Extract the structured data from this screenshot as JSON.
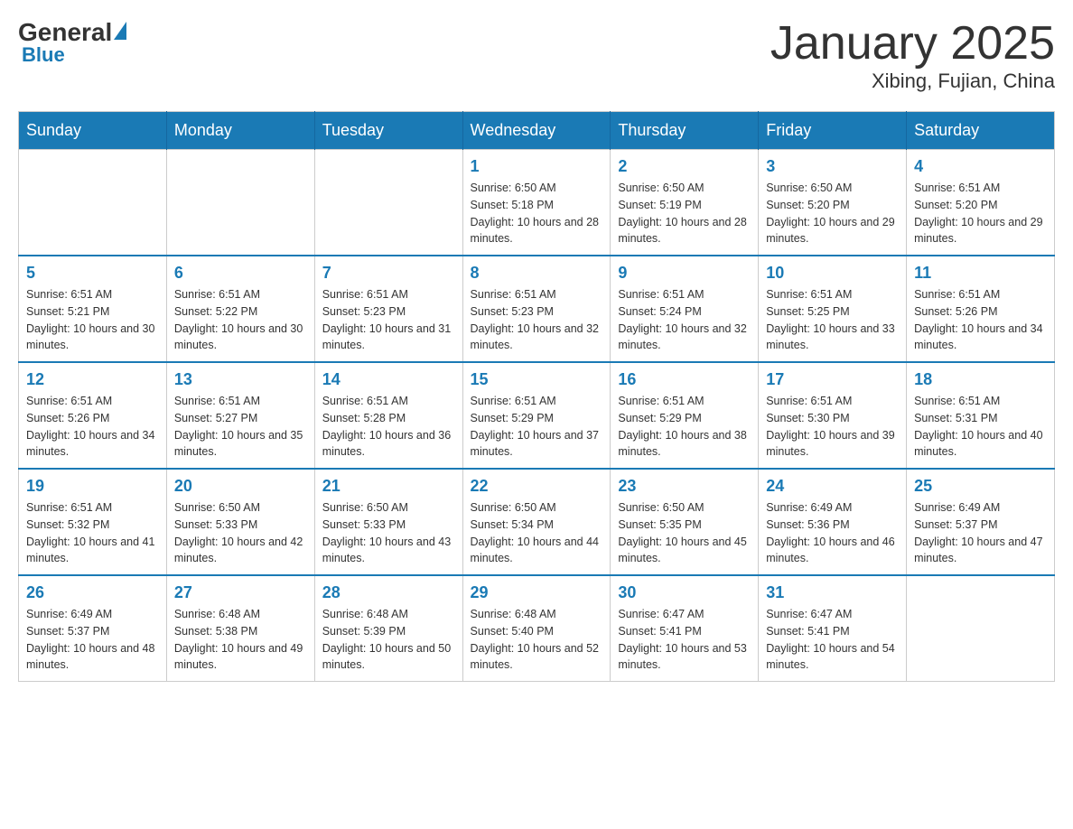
{
  "header": {
    "logo_general": "General",
    "logo_blue": "Blue",
    "month_title": "January 2025",
    "location": "Xibing, Fujian, China"
  },
  "days_of_week": [
    "Sunday",
    "Monday",
    "Tuesday",
    "Wednesday",
    "Thursday",
    "Friday",
    "Saturday"
  ],
  "weeks": [
    [
      {
        "day": "",
        "info": ""
      },
      {
        "day": "",
        "info": ""
      },
      {
        "day": "",
        "info": ""
      },
      {
        "day": "1",
        "info": "Sunrise: 6:50 AM\nSunset: 5:18 PM\nDaylight: 10 hours and 28 minutes."
      },
      {
        "day": "2",
        "info": "Sunrise: 6:50 AM\nSunset: 5:19 PM\nDaylight: 10 hours and 28 minutes."
      },
      {
        "day": "3",
        "info": "Sunrise: 6:50 AM\nSunset: 5:20 PM\nDaylight: 10 hours and 29 minutes."
      },
      {
        "day": "4",
        "info": "Sunrise: 6:51 AM\nSunset: 5:20 PM\nDaylight: 10 hours and 29 minutes."
      }
    ],
    [
      {
        "day": "5",
        "info": "Sunrise: 6:51 AM\nSunset: 5:21 PM\nDaylight: 10 hours and 30 minutes."
      },
      {
        "day": "6",
        "info": "Sunrise: 6:51 AM\nSunset: 5:22 PM\nDaylight: 10 hours and 30 minutes."
      },
      {
        "day": "7",
        "info": "Sunrise: 6:51 AM\nSunset: 5:23 PM\nDaylight: 10 hours and 31 minutes."
      },
      {
        "day": "8",
        "info": "Sunrise: 6:51 AM\nSunset: 5:23 PM\nDaylight: 10 hours and 32 minutes."
      },
      {
        "day": "9",
        "info": "Sunrise: 6:51 AM\nSunset: 5:24 PM\nDaylight: 10 hours and 32 minutes."
      },
      {
        "day": "10",
        "info": "Sunrise: 6:51 AM\nSunset: 5:25 PM\nDaylight: 10 hours and 33 minutes."
      },
      {
        "day": "11",
        "info": "Sunrise: 6:51 AM\nSunset: 5:26 PM\nDaylight: 10 hours and 34 minutes."
      }
    ],
    [
      {
        "day": "12",
        "info": "Sunrise: 6:51 AM\nSunset: 5:26 PM\nDaylight: 10 hours and 34 minutes."
      },
      {
        "day": "13",
        "info": "Sunrise: 6:51 AM\nSunset: 5:27 PM\nDaylight: 10 hours and 35 minutes."
      },
      {
        "day": "14",
        "info": "Sunrise: 6:51 AM\nSunset: 5:28 PM\nDaylight: 10 hours and 36 minutes."
      },
      {
        "day": "15",
        "info": "Sunrise: 6:51 AM\nSunset: 5:29 PM\nDaylight: 10 hours and 37 minutes."
      },
      {
        "day": "16",
        "info": "Sunrise: 6:51 AM\nSunset: 5:29 PM\nDaylight: 10 hours and 38 minutes."
      },
      {
        "day": "17",
        "info": "Sunrise: 6:51 AM\nSunset: 5:30 PM\nDaylight: 10 hours and 39 minutes."
      },
      {
        "day": "18",
        "info": "Sunrise: 6:51 AM\nSunset: 5:31 PM\nDaylight: 10 hours and 40 minutes."
      }
    ],
    [
      {
        "day": "19",
        "info": "Sunrise: 6:51 AM\nSunset: 5:32 PM\nDaylight: 10 hours and 41 minutes."
      },
      {
        "day": "20",
        "info": "Sunrise: 6:50 AM\nSunset: 5:33 PM\nDaylight: 10 hours and 42 minutes."
      },
      {
        "day": "21",
        "info": "Sunrise: 6:50 AM\nSunset: 5:33 PM\nDaylight: 10 hours and 43 minutes."
      },
      {
        "day": "22",
        "info": "Sunrise: 6:50 AM\nSunset: 5:34 PM\nDaylight: 10 hours and 44 minutes."
      },
      {
        "day": "23",
        "info": "Sunrise: 6:50 AM\nSunset: 5:35 PM\nDaylight: 10 hours and 45 minutes."
      },
      {
        "day": "24",
        "info": "Sunrise: 6:49 AM\nSunset: 5:36 PM\nDaylight: 10 hours and 46 minutes."
      },
      {
        "day": "25",
        "info": "Sunrise: 6:49 AM\nSunset: 5:37 PM\nDaylight: 10 hours and 47 minutes."
      }
    ],
    [
      {
        "day": "26",
        "info": "Sunrise: 6:49 AM\nSunset: 5:37 PM\nDaylight: 10 hours and 48 minutes."
      },
      {
        "day": "27",
        "info": "Sunrise: 6:48 AM\nSunset: 5:38 PM\nDaylight: 10 hours and 49 minutes."
      },
      {
        "day": "28",
        "info": "Sunrise: 6:48 AM\nSunset: 5:39 PM\nDaylight: 10 hours and 50 minutes."
      },
      {
        "day": "29",
        "info": "Sunrise: 6:48 AM\nSunset: 5:40 PM\nDaylight: 10 hours and 52 minutes."
      },
      {
        "day": "30",
        "info": "Sunrise: 6:47 AM\nSunset: 5:41 PM\nDaylight: 10 hours and 53 minutes."
      },
      {
        "day": "31",
        "info": "Sunrise: 6:47 AM\nSunset: 5:41 PM\nDaylight: 10 hours and 54 minutes."
      },
      {
        "day": "",
        "info": ""
      }
    ]
  ]
}
